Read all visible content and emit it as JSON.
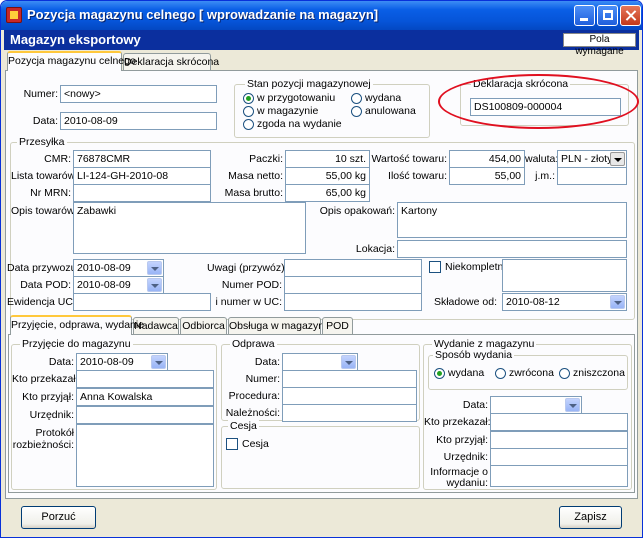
{
  "window": {
    "title": "Pozycja magazynu celnego [ wprowadzanie na magazyn]"
  },
  "header": {
    "title": "Magazyn eksportowy",
    "pola_button": "Pola wymagane"
  },
  "tabs_top": [
    "Pozycja magazynu celnego",
    "Deklaracja skrócona"
  ],
  "top": {
    "numer_label": "Numer:",
    "numer_value": "<nowy>",
    "data_label": "Data:",
    "data_value": "2010-08-09",
    "stan_title": "Stan pozycji magazynowej",
    "stan_options": [
      "w przygotowaniu",
      "w magazynie",
      "zgoda na wydanie",
      "wydana",
      "anulowana"
    ],
    "stan_selected": "w przygotowaniu",
    "deklaracja_title": "Deklaracja skrócona",
    "deklaracja_value": "DS100809-000004"
  },
  "przesylka": {
    "title": "Przesyłka",
    "cmr_label": "CMR:",
    "cmr_value": "76878CMR",
    "lista_label": "Lista towarów:",
    "lista_value": "LI-124-GH-2010-08",
    "mrn_label": "Nr MRN:",
    "mrn_value": "",
    "paczki_label": "Paczki:",
    "paczki_value": "10 szt.",
    "masa_netto_label": "Masa netto:",
    "masa_netto_value": "55,00 kg",
    "masa_brutto_label": "Masa brutto:",
    "masa_brutto_value": "65,00 kg",
    "wartosc_label": "Wartość towaru:",
    "wartosc_value": "454,00",
    "ilosc_label": "Ilość towaru:",
    "ilosc_value": "55,00",
    "waluta_label": "waluta:",
    "waluta_value": "PLN - złoty",
    "jm_label": "j.m.:",
    "jm_value": "",
    "opis_towarow_label": "Opis towarów:",
    "opis_towarow_value": "Zabawki",
    "opis_opakowan_label": "Opis opakowań:",
    "opis_opakowan_value": "Kartony",
    "lokacja_label": "Lokacja:",
    "lokacja_value": "",
    "data_przywozu_label": "Data przywozu:",
    "data_przywozu_value": "2010-08-09",
    "data_pod_label": "Data POD:",
    "data_pod_value": "2010-08-09",
    "ewidencja_label": "Ewidencja UC:",
    "ewidencja_value": "",
    "uwagi_label": "Uwagi (przywóz):",
    "uwagi_value": "",
    "numer_pod_label": "Numer POD:",
    "numer_pod_value": "",
    "i_numer_label": "i numer w UC:",
    "i_numer_value": "",
    "niekompletna_label": "Niekompletna",
    "skladowe_label": "Składowe od:",
    "skladowe_value": "2010-08-12"
  },
  "tabs_bottom": [
    "Przyjęcie, odprawa, wydanie",
    "Nadawca",
    "Odbiorca",
    "Obsługa w magazynie",
    "POD"
  ],
  "przyjecie": {
    "title": "Przyjęcie do magazynu",
    "data_label": "Data:",
    "data_value": "2010-08-09",
    "kto_przekazal_label": "Kto przekazał:",
    "kto_przekazal_value": "",
    "kto_przyjal_label": "Kto przyjął:",
    "kto_przyjal_value": "Anna Kowalska",
    "urzednik_label": "Urzędnik:",
    "urzednik_value": "",
    "protokol_label_1": "Protokół",
    "protokol_label_2": "rozbieżności:"
  },
  "odprawa": {
    "title": "Odprawa",
    "data_label": "Data:",
    "data_value": "",
    "numer_label": "Numer:",
    "numer_value": "",
    "procedura_label": "Procedura:",
    "procedura_value": "",
    "naleznosci_label": "Należności:",
    "naleznosci_value": ""
  },
  "cesja": {
    "title": "Cesja",
    "check_label": "Cesja"
  },
  "wydanie": {
    "title": "Wydanie z magazynu",
    "sposob_title": "Sposób wydania",
    "sposob_options": [
      "wydana",
      "zwrócona",
      "zniszczona"
    ],
    "sposob_selected": "wydana",
    "data_label": "Data:",
    "data_value": "",
    "kto_przekazal_label": "Kto przekazał:",
    "kto_przyjal_label": "Kto przyjął:",
    "urzednik_label": "Urzędnik:",
    "informacje_label_1": "Informacje o",
    "informacje_label_2": "wydaniu:"
  },
  "buttons": {
    "cancel": "Porzuć",
    "save": "Zapisz"
  },
  "colors": {
    "titlebar": "#0654d8",
    "header": "#0b2f9e",
    "highlight_oval": "#e01020"
  }
}
